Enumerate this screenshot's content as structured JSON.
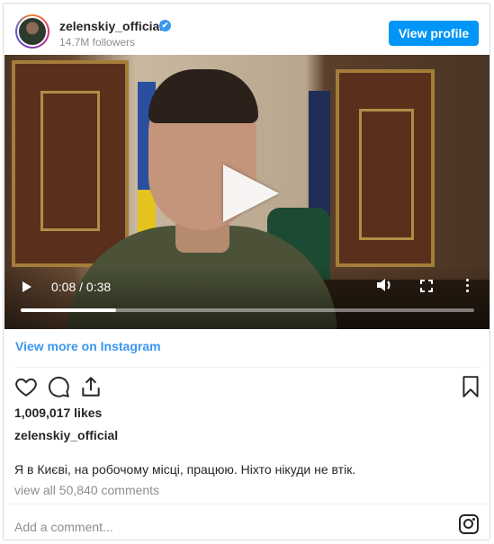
{
  "header": {
    "username": "zelenskiy_official",
    "verified_icon": "✔",
    "followers": "14.7M followers",
    "view_profile_label": "View profile"
  },
  "video": {
    "time": "0:08 / 0:38",
    "progress": 0.21
  },
  "links": {
    "view_more": "View more on Instagram"
  },
  "post": {
    "likes": "1,009,017 likes",
    "caption_user": "zelenskiy_official",
    "caption": "Я в Києві, на робочому місці, працюю. Ніхто нікуди не втік.",
    "view_comments": "view all 50,840 comments"
  },
  "comment": {
    "placeholder": "Add a comment..."
  },
  "icons": {
    "like": "heart-icon",
    "comment": "comment-icon",
    "share": "share-icon",
    "save": "bookmark-icon",
    "instagram": "instagram-icon"
  },
  "colors": {
    "accent": "#0095f6",
    "link": "#3897f0",
    "muted": "#8e8e8e"
  }
}
